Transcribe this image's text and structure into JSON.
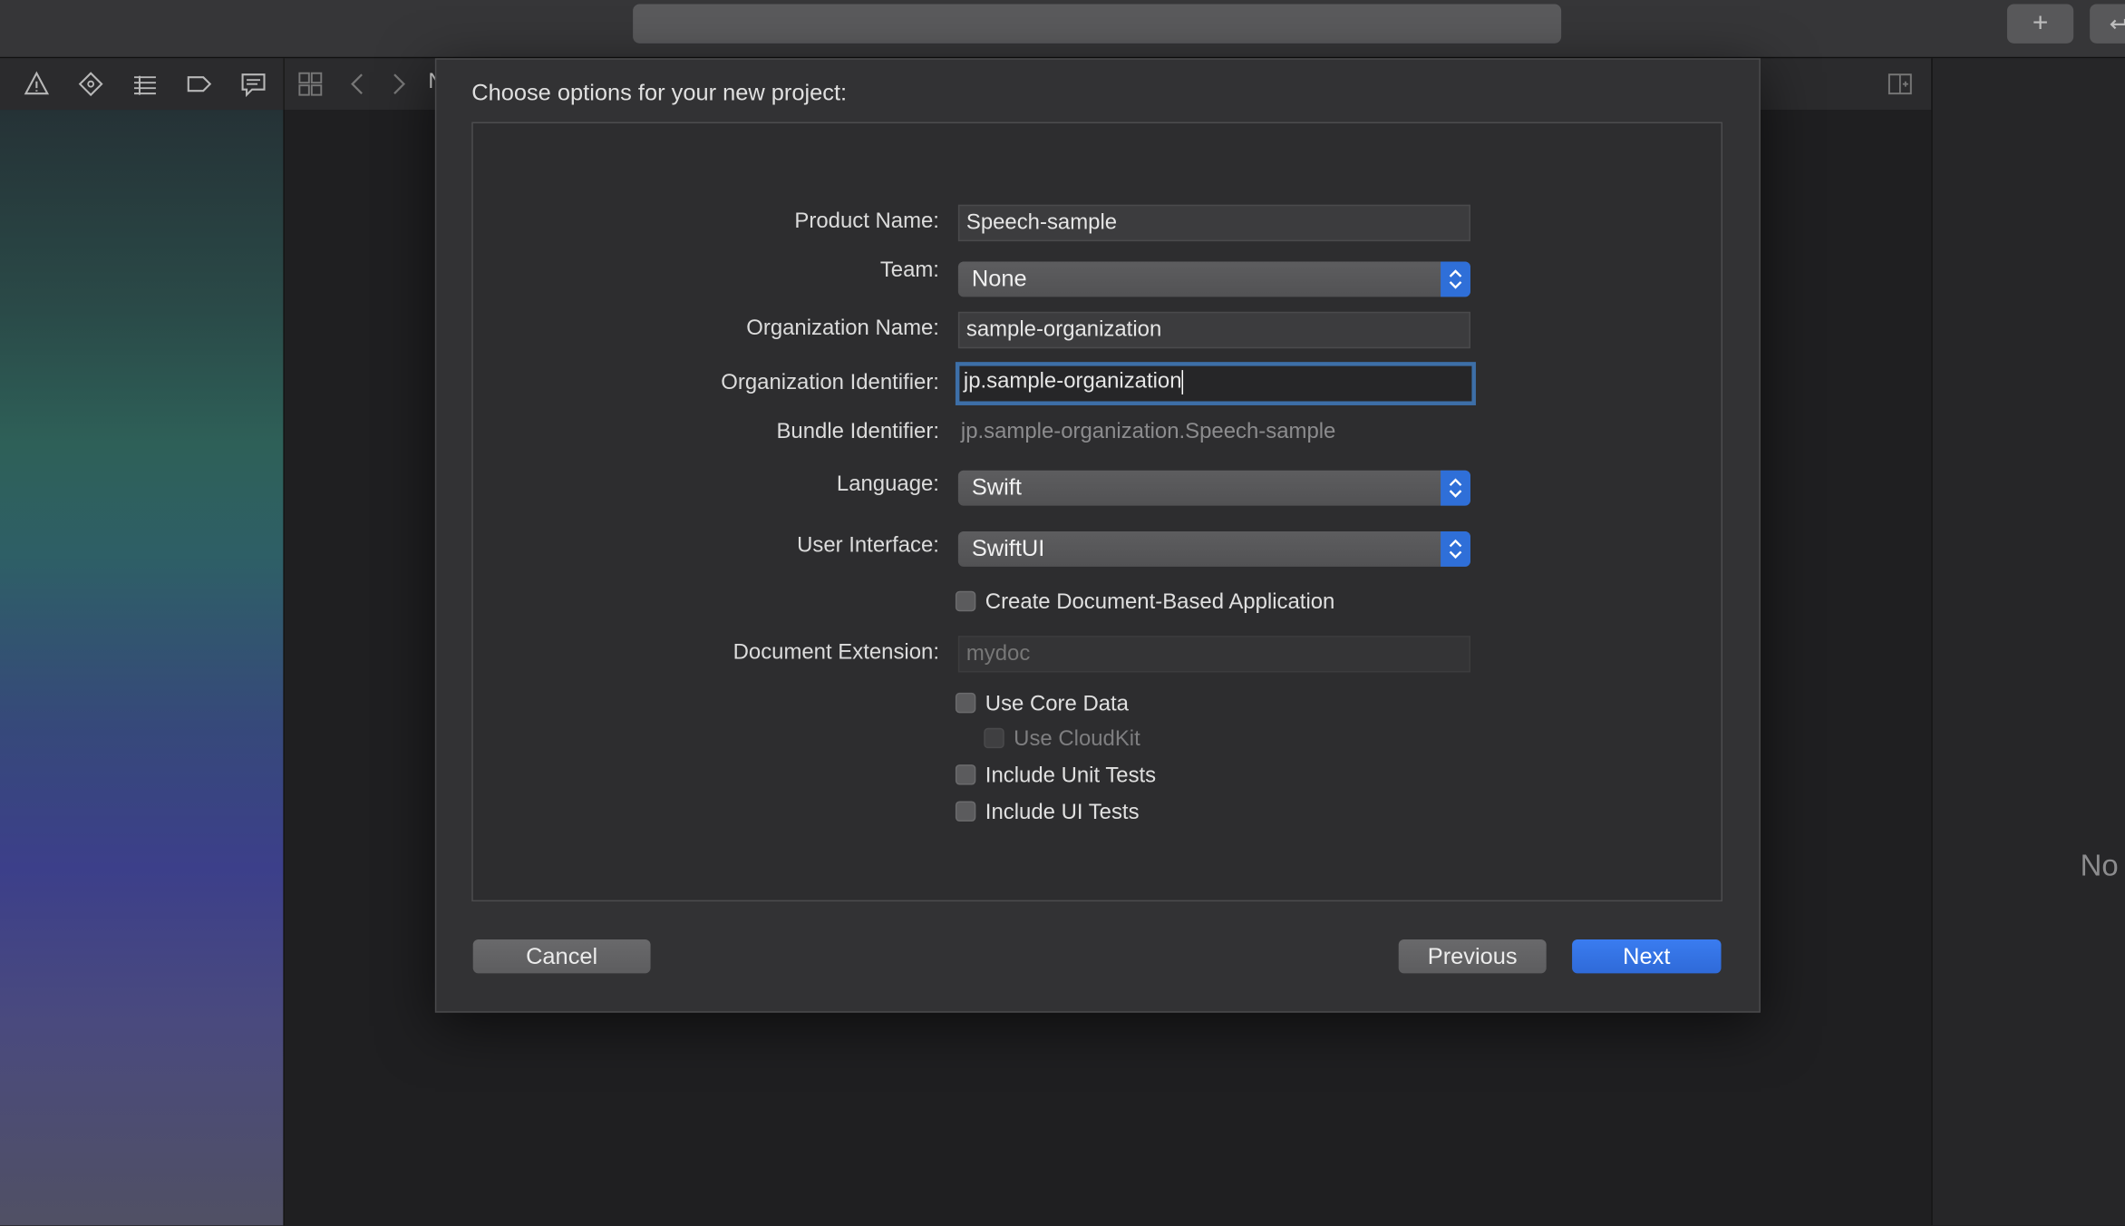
{
  "dialog": {
    "title": "Choose options for your new project:",
    "fields": {
      "product_name": {
        "label": "Product Name:",
        "value": "Speech-sample"
      },
      "team": {
        "label": "Team:",
        "value": "None"
      },
      "organization_name": {
        "label": "Organization Name:",
        "value": "sample-organization"
      },
      "organization_identifier": {
        "label": "Organization Identifier:",
        "value": "jp.sample-organization"
      },
      "bundle_identifier": {
        "label": "Bundle Identifier:",
        "value": "jp.sample-organization.Speech-sample"
      },
      "language": {
        "label": "Language:",
        "value": "Swift"
      },
      "user_interface": {
        "label": "User Interface:",
        "value": "SwiftUI"
      },
      "document_extension": {
        "label": "Document Extension:",
        "placeholder": "mydoc"
      }
    },
    "checkboxes": {
      "create_document_based": {
        "label": "Create Document-Based Application",
        "checked": false
      },
      "use_core_data": {
        "label": "Use Core Data",
        "checked": false
      },
      "use_cloudkit": {
        "label": "Use CloudKit",
        "checked": false,
        "enabled": false
      },
      "include_unit_tests": {
        "label": "Include Unit Tests",
        "checked": false
      },
      "include_ui_tests": {
        "label": "Include UI Tests",
        "checked": false
      }
    },
    "buttons": {
      "cancel": "Cancel",
      "previous": "Previous",
      "next": "Next"
    }
  },
  "toolbar": {
    "add_label": "+",
    "icons": [
      "warning-icon",
      "breakpoint-icon",
      "list-icon",
      "tag-icon",
      "comment-icon",
      "grid-icon",
      "chevron-left-icon",
      "chevron-right-icon",
      "add-editor-icon",
      "file-icon"
    ]
  },
  "editor": {
    "truncated_tab_label": "N"
  },
  "inspector": {
    "no_selection_text": "No"
  },
  "colors": {
    "accent": "#2f6fd8",
    "focus_ring": "#3d6fa8"
  }
}
